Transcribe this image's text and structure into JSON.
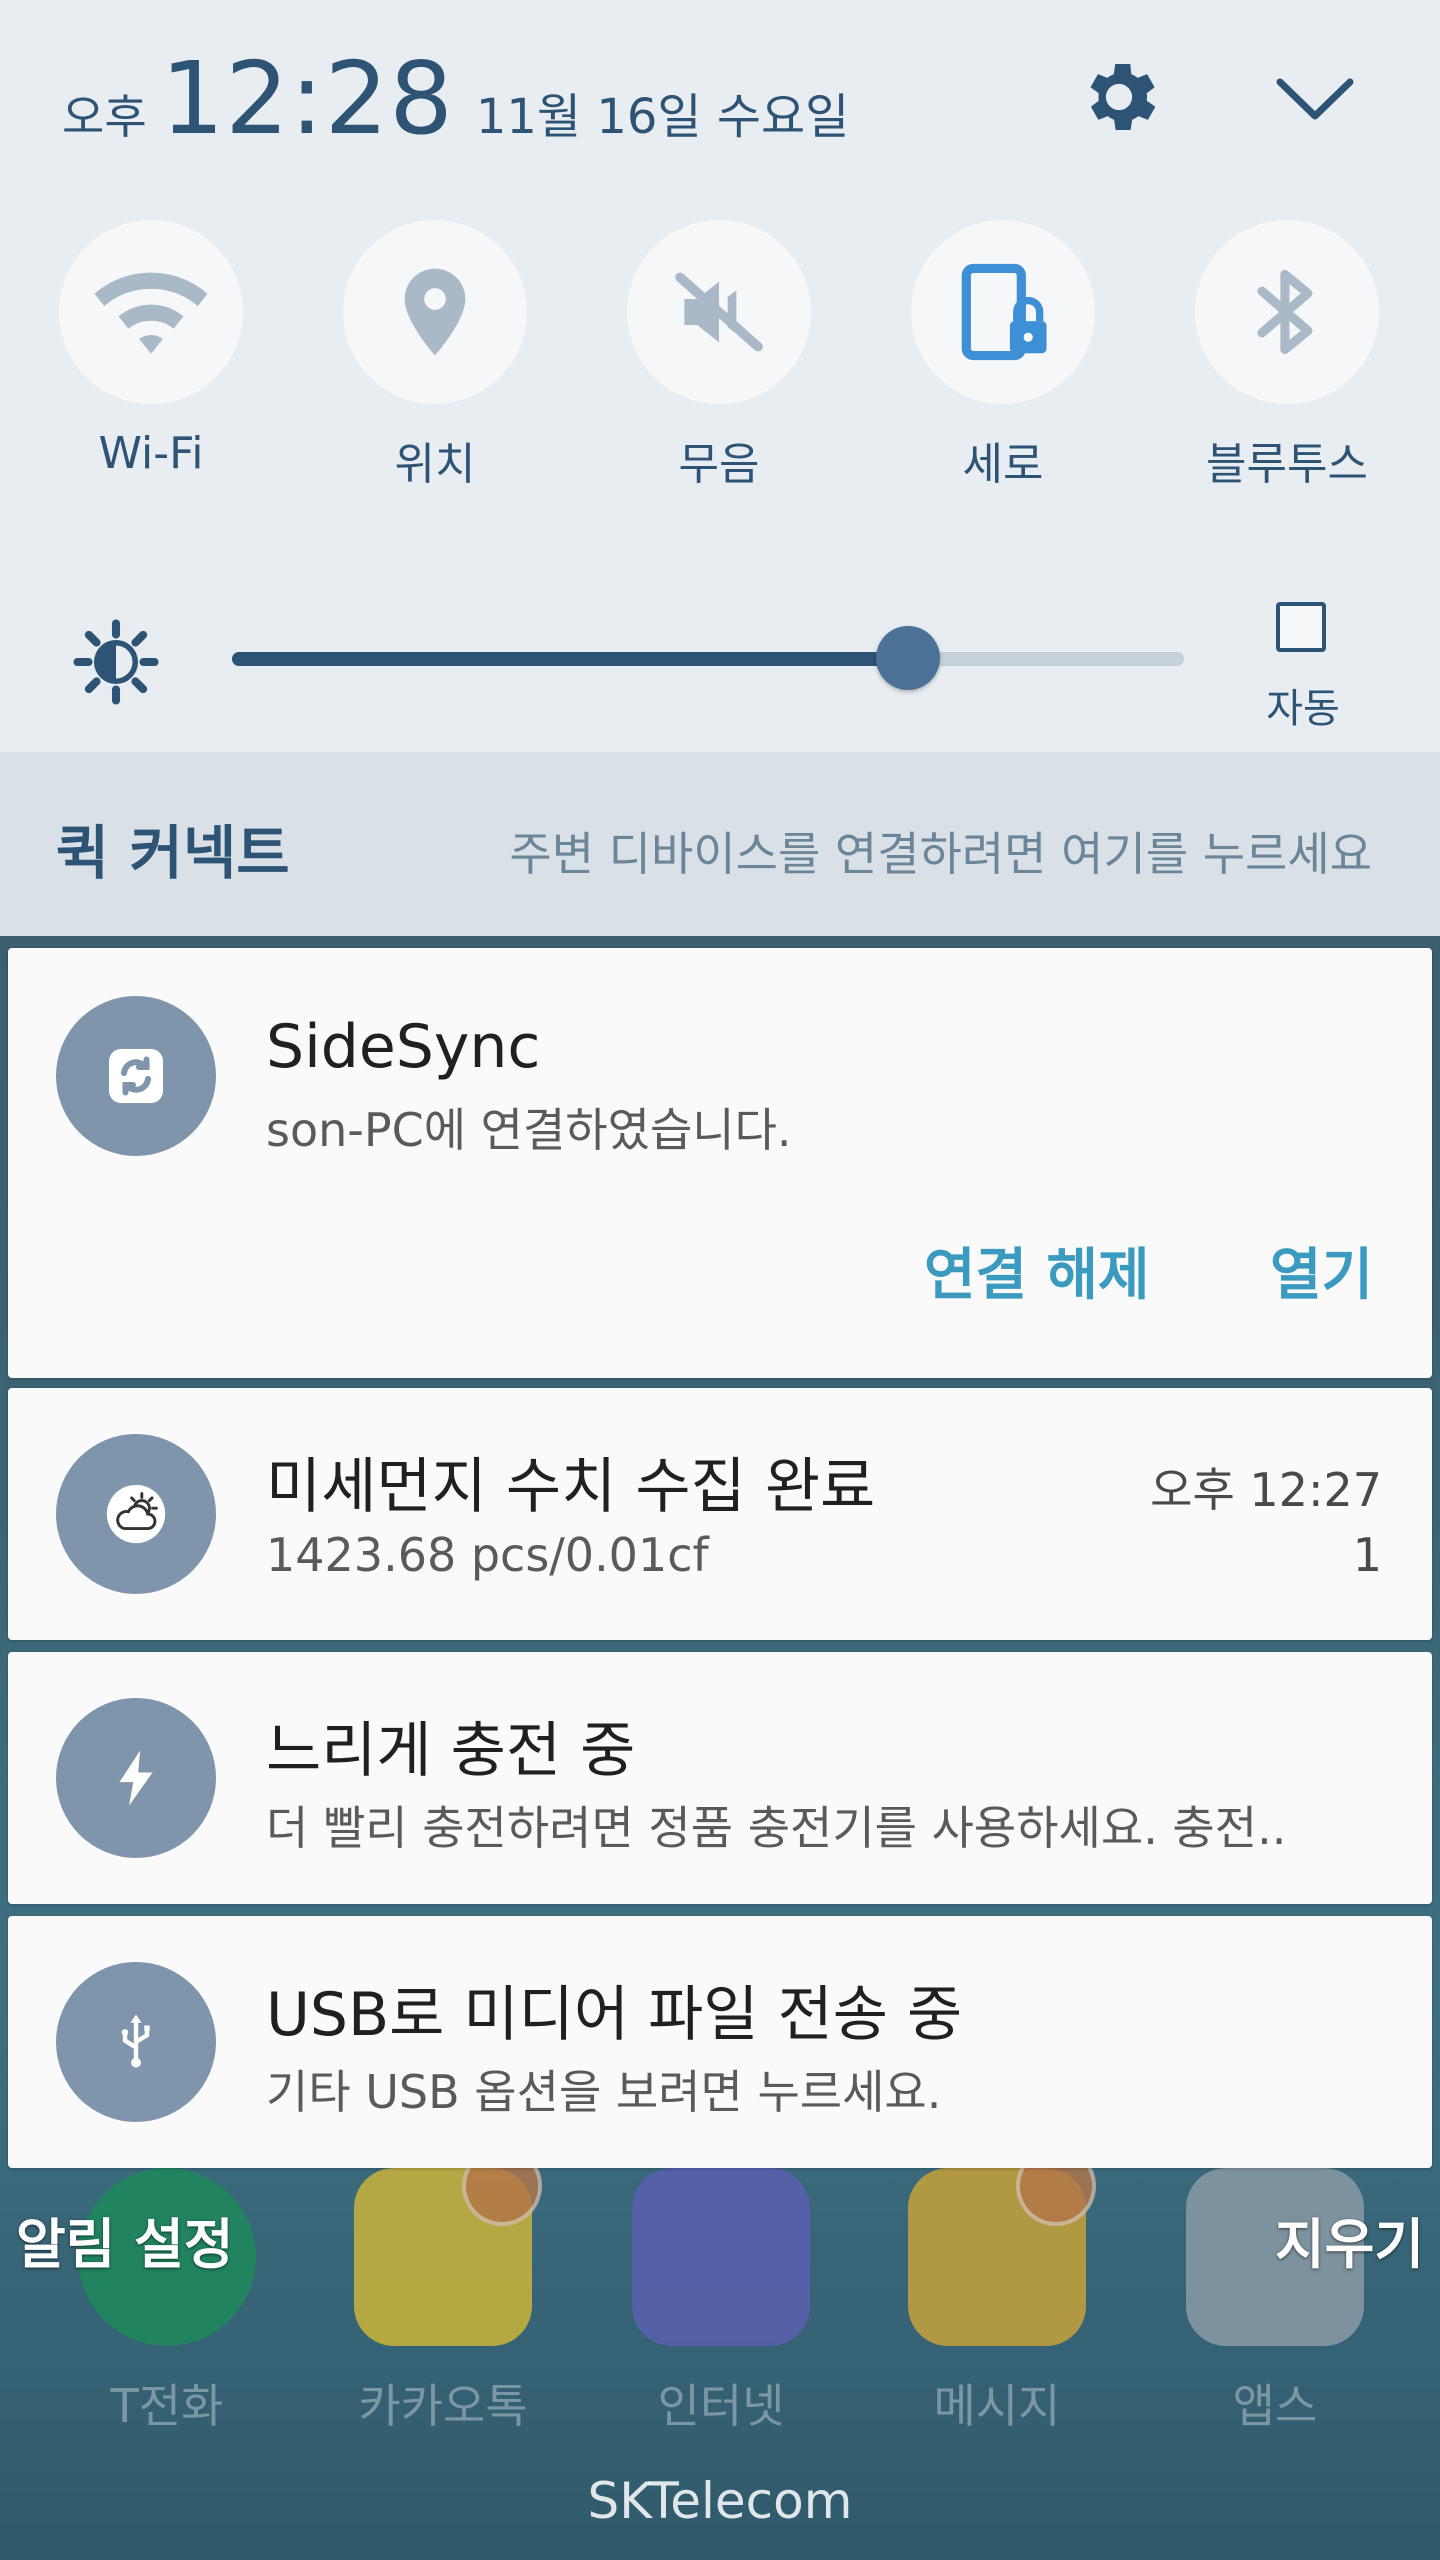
{
  "header": {
    "ampm": "오후",
    "clock": "12:28",
    "date": "11월 16일 수요일",
    "icons": {
      "settings": "gear-icon",
      "collapse": "chevron-down-icon"
    }
  },
  "quick_settings": [
    {
      "id": "wifi",
      "label": "Wi-Fi",
      "icon": "wifi-icon",
      "active": false
    },
    {
      "id": "location",
      "label": "위치",
      "icon": "location-icon",
      "active": false
    },
    {
      "id": "mute",
      "label": "무음",
      "icon": "mute-icon",
      "active": false
    },
    {
      "id": "rotation",
      "label": "세로",
      "icon": "portrait-lock-icon",
      "active": true
    },
    {
      "id": "bluetooth",
      "label": "블루투스",
      "icon": "bluetooth-icon",
      "active": false
    }
  ],
  "brightness": {
    "level": 0.71,
    "auto_label": "자동",
    "auto_checked": false
  },
  "quick_connect": {
    "title": "퀵 커넥트",
    "hint": "주변 디바이스를 연결하려면 여기를 누르세요"
  },
  "notifications": [
    {
      "id": "sidesync",
      "app_icon": "sidesync-icon",
      "title": "SideSync",
      "text": "son-PC에 연결하였습니다.",
      "actions": [
        "연결 해제",
        "열기"
      ]
    },
    {
      "id": "dust",
      "app_icon": "weather-icon",
      "title": "미세먼지 수치 수집 완료",
      "text": "1423.68 pcs/0.01cf",
      "time": "오후 12:27",
      "count": "1"
    },
    {
      "id": "charging",
      "app_icon": "lightning-icon",
      "title": "느리게 충전 중",
      "text": "더 빨리 충전하려면 정품 충전기를 사용하세요. 충전.."
    },
    {
      "id": "usb",
      "app_icon": "usb-icon",
      "title": "USB로 미디어 파일 전송 중",
      "text": "기타 USB 옵션을 보려면 누르세요."
    }
  ],
  "footer": {
    "notification_settings": "알림 설정",
    "clear_all": "지우기",
    "carrier": "SKTelecom"
  },
  "dock": [
    {
      "label": "T전화",
      "icon": "phone-icon",
      "color": "#1f8a5a"
    },
    {
      "label": "카카오톡",
      "icon": "kakaotalk-icon",
      "color": "#c9b43a"
    },
    {
      "label": "인터넷",
      "icon": "globe-icon",
      "color": "#5a5fb0"
    },
    {
      "label": "메시지",
      "icon": "envelope-icon",
      "color": "#c7a13a"
    },
    {
      "label": "앱스",
      "icon": "apps-grid-icon",
      "color": "#8a9aa6"
    }
  ],
  "colors": {
    "accent": "#2d5375",
    "action": "#3b9abf",
    "active_tile": "#3d8fd6",
    "inactive_tile": "#a9b9c7"
  }
}
